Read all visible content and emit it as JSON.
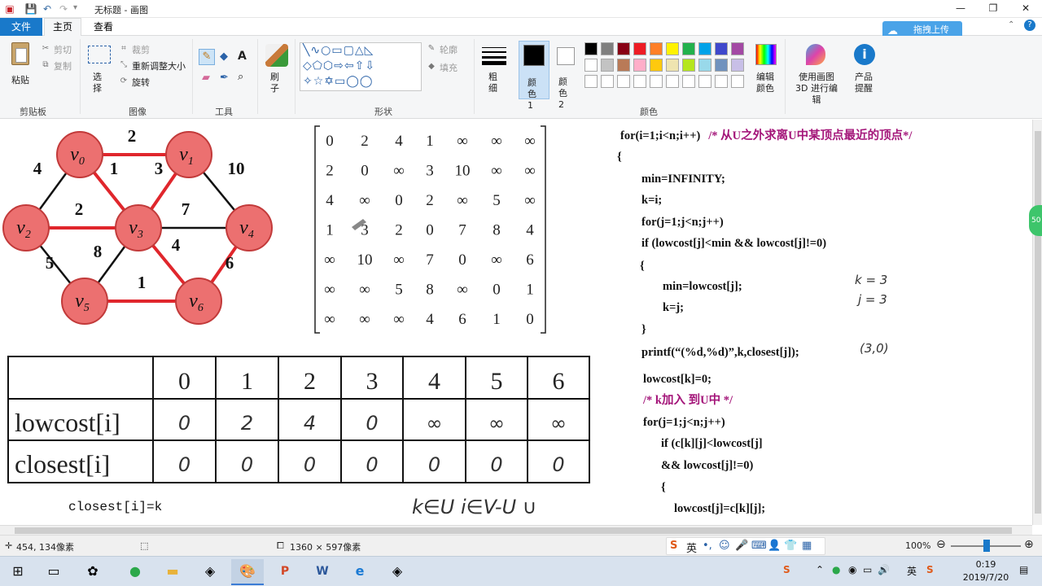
{
  "titlebar": {
    "title": "无标题 - 画图",
    "separator": "▾",
    "buttons": {
      "minimize": "—",
      "maximize": "❐",
      "close": "✕"
    }
  },
  "tabs": {
    "file": "文件",
    "home": "主页",
    "view": "查看"
  },
  "upload": {
    "label": "拖拽上传"
  },
  "ribbon": {
    "clipboard": {
      "paste": "粘贴",
      "cut": "剪切",
      "copy": "复制",
      "group": "剪贴板"
    },
    "image": {
      "select": "选择",
      "crop": "裁剪",
      "resize": "重新调整大小",
      "rotate": "旋转",
      "group": "图像"
    },
    "tools": {
      "group": "工具"
    },
    "brush": {
      "label": "刷子"
    },
    "shapes": {
      "outline": "轮廓",
      "fill": "填充",
      "group": "形状"
    },
    "size": {
      "label": "粗细"
    },
    "colors": {
      "color1": "颜色 1",
      "color2": "颜色 2",
      "edit": "编辑颜色",
      "paint3d": "使用画图 3D 进行编辑",
      "product": "产品提醒",
      "group": "颜色",
      "palette": [
        "#000000",
        "#7f7f7f",
        "#880015",
        "#ed1c24",
        "#ff7f27",
        "#fff200",
        "#22b14c",
        "#00a2e8",
        "#3f48cc",
        "#a349a4",
        "#ffffff",
        "#c3c3c3",
        "#b97a57",
        "#ffaec9",
        "#ffc90e",
        "#efe4b0",
        "#b5e61d",
        "#99d9ea",
        "#7092be",
        "#c8bfe7",
        "#ffffff",
        "#ffffff",
        "#ffffff",
        "#ffffff",
        "#ffffff",
        "#ffffff",
        "#ffffff",
        "#ffffff",
        "#ffffff",
        "#ffffff"
      ]
    }
  },
  "graph": {
    "vertices": [
      {
        "label": "v",
        "sub": "0"
      },
      {
        "label": "v",
        "sub": "1"
      },
      {
        "label": "v",
        "sub": "2"
      },
      {
        "label": "v",
        "sub": "3"
      },
      {
        "label": "v",
        "sub": "4"
      },
      {
        "label": "v",
        "sub": "5"
      },
      {
        "label": "v",
        "sub": "6"
      }
    ],
    "edges": [
      {
        "from": 0,
        "to": 1,
        "weight": "2",
        "mst": true
      },
      {
        "from": 0,
        "to": 2,
        "weight": "4",
        "mst": false
      },
      {
        "from": 0,
        "to": 3,
        "weight": "1",
        "mst": true
      },
      {
        "from": 1,
        "to": 3,
        "weight": "3",
        "mst": true
      },
      {
        "from": 1,
        "to": 4,
        "weight": "10",
        "mst": false
      },
      {
        "from": 2,
        "to": 3,
        "weight": "2",
        "mst": true
      },
      {
        "from": 3,
        "to": 4,
        "weight": "7",
        "mst": false
      },
      {
        "from": 2,
        "to": 5,
        "weight": "5",
        "mst": false
      },
      {
        "from": 3,
        "to": 5,
        "weight": "8",
        "mst": false
      },
      {
        "from": 3,
        "to": 6,
        "weight": "4",
        "mst": true
      },
      {
        "from": 4,
        "to": 6,
        "weight": "6",
        "mst": true
      },
      {
        "from": 5,
        "to": 6,
        "weight": "1",
        "mst": true
      }
    ]
  },
  "matrix": [
    [
      "0",
      "2",
      "4",
      "1",
      "∞",
      "∞",
      "∞"
    ],
    [
      "2",
      "0",
      "∞",
      "3",
      "10",
      "∞",
      "∞"
    ],
    [
      "4",
      "∞",
      "0",
      "2",
      "∞",
      "5",
      "∞"
    ],
    [
      "1",
      "3",
      "2",
      "0",
      "7",
      "8",
      "4"
    ],
    [
      "∞",
      "10",
      "∞",
      "7",
      "0",
      "∞",
      "6"
    ],
    [
      "∞",
      "∞",
      "5",
      "8",
      "∞",
      "0",
      "1"
    ],
    [
      "∞",
      "∞",
      "∞",
      "4",
      "6",
      "1",
      "0"
    ]
  ],
  "table": {
    "headers": [
      "0",
      "1",
      "2",
      "3",
      "4",
      "5",
      "6"
    ],
    "rows": [
      {
        "label": "lowcost[i]",
        "values": [
          "0",
          "2",
          "4",
          "0",
          "∞",
          "∞",
          "∞"
        ]
      },
      {
        "label": "closest[i]",
        "values": [
          "0",
          "0",
          "0",
          "0",
          "0",
          "0",
          "0"
        ]
      }
    ]
  },
  "notes": {
    "closest_eq": "closest[i]=k",
    "membership": "k∈U   i∈V-U ∪",
    "k_val": "k = 3",
    "j_val": "j = 3",
    "pair": "(3,0)"
  },
  "code": [
    {
      "text": "for(i=1;i<n;i++)",
      "comment": "/* 从U之外求离U中某顶点最近的顶点*/"
    },
    {
      "text": "{",
      "comment": ""
    },
    {
      "text": "min=INFINITY;",
      "comment": ""
    },
    {
      "text": "k=i;",
      "comment": ""
    },
    {
      "text": "for(j=1;j<n;j++)",
      "comment": ""
    },
    {
      "text": "if (lowcost[j]<min && lowcost[j]!=0)",
      "comment": ""
    },
    {
      "text": "{",
      "comment": ""
    },
    {
      "text": "min=lowcost[j];",
      "comment": ""
    },
    {
      "text": "k=j;",
      "comment": ""
    },
    {
      "text": "}",
      "comment": ""
    },
    {
      "text": "printf(“(%d,%d)”,k,closest[j]);",
      "comment": ""
    },
    {
      "text": "lowcost[k]=0;",
      "comment": ""
    },
    {
      "text": "",
      "comment": "/* k加入 到U中 */"
    },
    {
      "text": "for(j=1;j<n;j++)",
      "comment": ""
    },
    {
      "text": "if (c[k][j]<lowcost[j]",
      "comment": ""
    },
    {
      "text": "&& lowcost[j]!=0)",
      "comment": ""
    },
    {
      "text": "{",
      "comment": ""
    },
    {
      "text": "lowcost[j]=c[k][j];",
      "comment": ""
    }
  ],
  "status": {
    "position": "454, 134像素",
    "canvas_size": "1360 × 597像素",
    "zoom": "100%",
    "ime_lang": "英"
  },
  "taskbar": {
    "lang": "英",
    "time": "0:19",
    "date": "2019/7/20"
  }
}
